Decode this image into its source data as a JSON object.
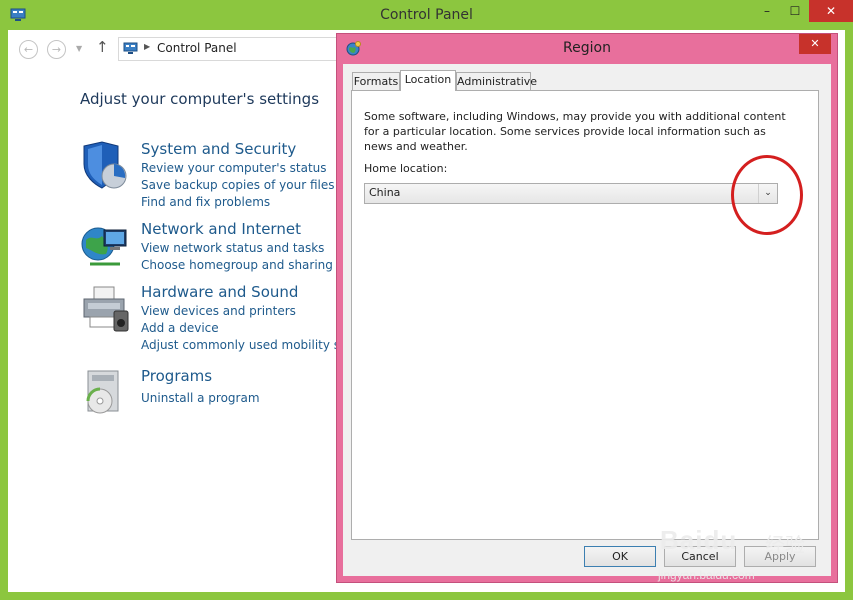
{
  "control_panel": {
    "title": "Control Panel",
    "address": "Control Panel",
    "nav": {
      "back_glyph": "←",
      "forward_glyph": "→",
      "recent_glyph": "▼",
      "up_glyph": "↑",
      "separator_glyph": "▶"
    },
    "window_controls": {
      "minimize": "–",
      "maximize": "☐",
      "close": "✕"
    },
    "heading": "Adjust your computer's settings",
    "categories": [
      {
        "icon": "shield-icon",
        "title": "System and Security",
        "links": [
          "Review your computer's status",
          "Save backup copies of your files with",
          "Find and fix problems"
        ]
      },
      {
        "icon": "network-globe-icon",
        "title": "Network and Internet",
        "links": [
          "View network status and tasks",
          "Choose homegroup and sharing opti"
        ]
      },
      {
        "icon": "printer-icon",
        "title": "Hardware and Sound",
        "links": [
          "View devices and printers",
          "Add a device",
          "Adjust commonly used mobility setti"
        ]
      },
      {
        "icon": "programs-disc-icon",
        "title": "Programs",
        "links": [
          "Uninstall a program"
        ]
      }
    ]
  },
  "region_dialog": {
    "title": "Region",
    "close_glyph": "✕",
    "tabs": [
      "Formats",
      "Location",
      "Administrative"
    ],
    "active_tab": "Location",
    "description": "Some software, including Windows, may provide you with additional content for a particular location. Some services provide local information such as news and weather.",
    "home_location_label": "Home location:",
    "home_location_value": "China",
    "dropdown_glyph": "⌄",
    "buttons": {
      "ok": "OK",
      "cancel": "Cancel",
      "apply": "Apply"
    }
  },
  "watermark": {
    "main": "Baidu",
    "cn": "经验",
    "sub": "jingyan.baidu.com"
  },
  "colors": {
    "window_frame": "#8cc63f",
    "dialog_frame": "#e86f9c",
    "link": "#1e5a8c",
    "annotation_circle": "#d41f1f"
  }
}
